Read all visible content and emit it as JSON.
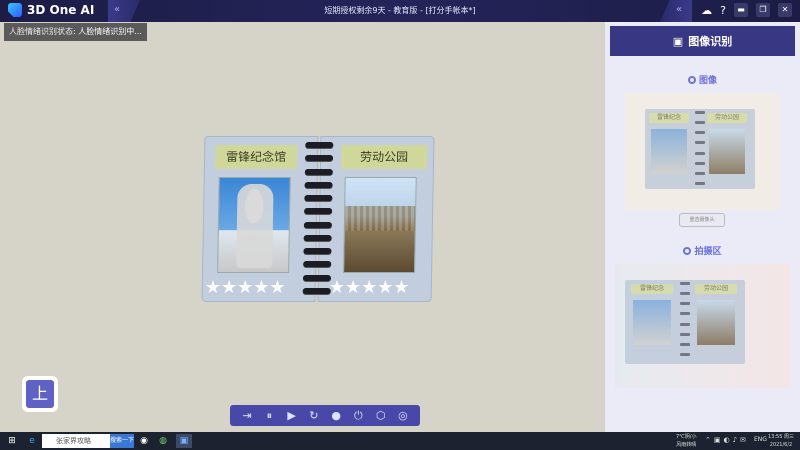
{
  "titlebar": {
    "app_name": "3D One AI",
    "window_title": "短期授权剩余9天 - 教育版 - [打分手帐本*]",
    "help": "?",
    "deco_left": "«",
    "deco_right": "«",
    "minimize": "▬",
    "restore": "❐",
    "close": "✕"
  },
  "status": {
    "label": "人脸情绪识别状态:",
    "value": "人脸情绪识别中..."
  },
  "scene": {
    "left_label": "雷锋纪念馆",
    "right_label": "劳动公园",
    "stars": "★★★★★"
  },
  "nav_button": {
    "label": "上"
  },
  "toolbar": {
    "icons": [
      "enter-icon",
      "pause-icon",
      "play-icon",
      "refresh-icon",
      "stop-icon",
      "power-icon",
      "settings-icon",
      "screenshot-icon"
    ]
  },
  "panel": {
    "header": "图像识别",
    "image_section": "图像",
    "camera_button": "重选摄像头",
    "capture_section": "拍摄区",
    "mini_left": "雷锋纪念",
    "mini_right": "劳动公园"
  },
  "taskbar": {
    "search_text": "张家界攻略",
    "search_button": "搜索一下",
    "weather_line1": "7℃阴/小",
    "weather_line2": "风雨转晴",
    "lang": "ENG",
    "time": "13:55 周三",
    "date": "2021/6/2"
  },
  "colors": {
    "titlebar": "#1c1c46",
    "panel_header": "#373784",
    "accent": "#6c72d8",
    "toolbar": "#4848a8",
    "canvas_bg": "#d6d3c8"
  }
}
